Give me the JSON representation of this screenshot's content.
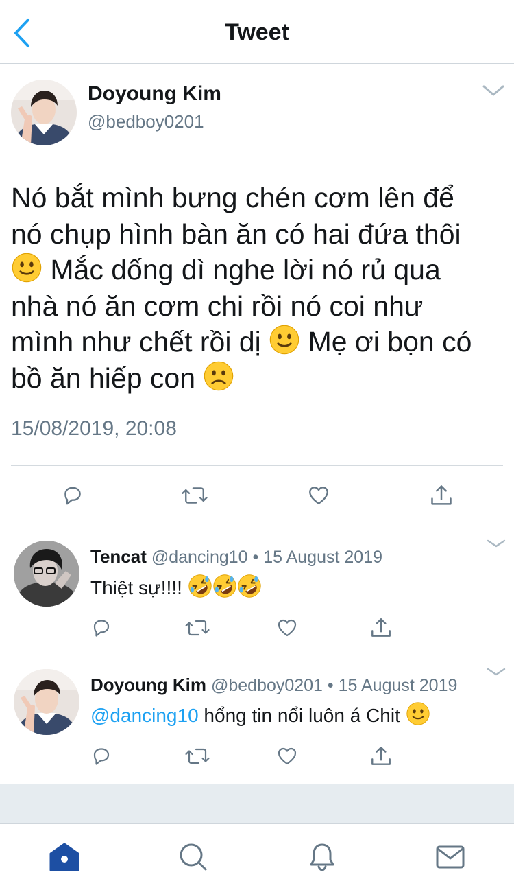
{
  "header": {
    "title": "Tweet"
  },
  "main_tweet": {
    "name": "Doyoung Kim",
    "handle": "@bedboy0201",
    "text_lines": [
      "Nó bắt mình bưng chén cơm lên để",
      "nó chụp hình bàn ăn có hai đứa thôi",
      "Mắc dống dì nghe lời nó rủ qua",
      "nhà nó ăn cơm chi rồi nó coi như",
      "mình như chết rồi dị",
      "Mẹ ơi bọn có",
      "bồ ăn hiếp con"
    ],
    "timestamp": "15/08/2019, 20:08"
  },
  "replies": [
    {
      "name": "Tencat",
      "meta": "@dancing10 • 15 August 2019",
      "text": "Thiệt sự!!!!"
    },
    {
      "name": "Doyoung Kim",
      "meta": "@bedboy0201 • 15 August 2019",
      "mention": "@dancing10",
      "text": " hổng tin nổi luôn á Chit"
    }
  ],
  "icons": {
    "back": "chevron-left-icon",
    "reply": "reply-icon",
    "retweet": "retweet-icon",
    "like": "heart-icon",
    "share": "share-icon",
    "home": "home-icon",
    "search": "search-icon",
    "notifications": "bell-icon",
    "messages": "mail-icon"
  },
  "colors": {
    "accent": "#1da1f2",
    "text_secondary": "#657786",
    "tab_active": "#1d4fa3",
    "tab_inactive": "#657786"
  }
}
